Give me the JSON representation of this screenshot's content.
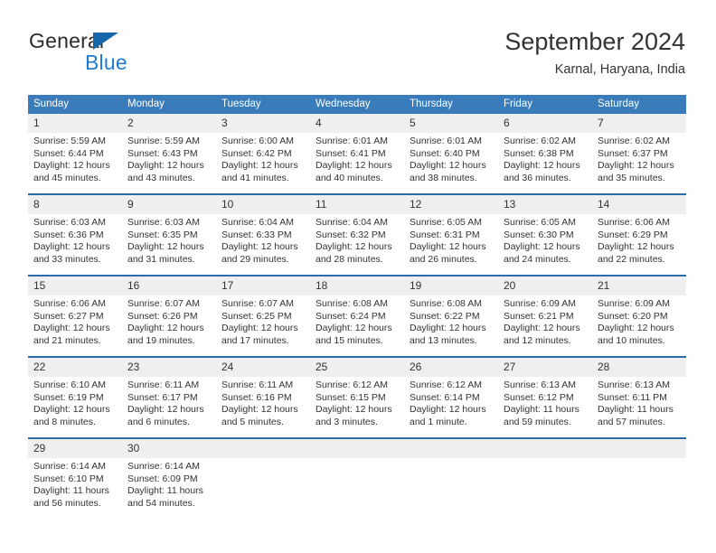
{
  "brand": {
    "name_part1": "General",
    "name_part2": "Blue",
    "triangle_color": "#1566ab",
    "blue_color": "#1f7dd1"
  },
  "header": {
    "title": "September 2024",
    "subtitle": "Karnal, Haryana, India"
  },
  "theme": {
    "header_bg": "#3a7cb9",
    "row_divider": "#2d6ca8",
    "daynum_bg": "#efefef",
    "text": "#333333"
  },
  "weekday_headers": [
    "Sunday",
    "Monday",
    "Tuesday",
    "Wednesday",
    "Thursday",
    "Friday",
    "Saturday"
  ],
  "labels": {
    "sunrise_prefix": "Sunrise: ",
    "sunset_prefix": "Sunset: ",
    "daylight_prefix": "Daylight: "
  },
  "weeks": [
    [
      {
        "day": "1",
        "sunrise": "Sunrise: 5:59 AM",
        "sunset": "Sunset: 6:44 PM",
        "daylight": "Daylight: 12 hours and 45 minutes."
      },
      {
        "day": "2",
        "sunrise": "Sunrise: 5:59 AM",
        "sunset": "Sunset: 6:43 PM",
        "daylight": "Daylight: 12 hours and 43 minutes."
      },
      {
        "day": "3",
        "sunrise": "Sunrise: 6:00 AM",
        "sunset": "Sunset: 6:42 PM",
        "daylight": "Daylight: 12 hours and 41 minutes."
      },
      {
        "day": "4",
        "sunrise": "Sunrise: 6:01 AM",
        "sunset": "Sunset: 6:41 PM",
        "daylight": "Daylight: 12 hours and 40 minutes."
      },
      {
        "day": "5",
        "sunrise": "Sunrise: 6:01 AM",
        "sunset": "Sunset: 6:40 PM",
        "daylight": "Daylight: 12 hours and 38 minutes."
      },
      {
        "day": "6",
        "sunrise": "Sunrise: 6:02 AM",
        "sunset": "Sunset: 6:38 PM",
        "daylight": "Daylight: 12 hours and 36 minutes."
      },
      {
        "day": "7",
        "sunrise": "Sunrise: 6:02 AM",
        "sunset": "Sunset: 6:37 PM",
        "daylight": "Daylight: 12 hours and 35 minutes."
      }
    ],
    [
      {
        "day": "8",
        "sunrise": "Sunrise: 6:03 AM",
        "sunset": "Sunset: 6:36 PM",
        "daylight": "Daylight: 12 hours and 33 minutes."
      },
      {
        "day": "9",
        "sunrise": "Sunrise: 6:03 AM",
        "sunset": "Sunset: 6:35 PM",
        "daylight": "Daylight: 12 hours and 31 minutes."
      },
      {
        "day": "10",
        "sunrise": "Sunrise: 6:04 AM",
        "sunset": "Sunset: 6:33 PM",
        "daylight": "Daylight: 12 hours and 29 minutes."
      },
      {
        "day": "11",
        "sunrise": "Sunrise: 6:04 AM",
        "sunset": "Sunset: 6:32 PM",
        "daylight": "Daylight: 12 hours and 28 minutes."
      },
      {
        "day": "12",
        "sunrise": "Sunrise: 6:05 AM",
        "sunset": "Sunset: 6:31 PM",
        "daylight": "Daylight: 12 hours and 26 minutes."
      },
      {
        "day": "13",
        "sunrise": "Sunrise: 6:05 AM",
        "sunset": "Sunset: 6:30 PM",
        "daylight": "Daylight: 12 hours and 24 minutes."
      },
      {
        "day": "14",
        "sunrise": "Sunrise: 6:06 AM",
        "sunset": "Sunset: 6:29 PM",
        "daylight": "Daylight: 12 hours and 22 minutes."
      }
    ],
    [
      {
        "day": "15",
        "sunrise": "Sunrise: 6:06 AM",
        "sunset": "Sunset: 6:27 PM",
        "daylight": "Daylight: 12 hours and 21 minutes."
      },
      {
        "day": "16",
        "sunrise": "Sunrise: 6:07 AM",
        "sunset": "Sunset: 6:26 PM",
        "daylight": "Daylight: 12 hours and 19 minutes."
      },
      {
        "day": "17",
        "sunrise": "Sunrise: 6:07 AM",
        "sunset": "Sunset: 6:25 PM",
        "daylight": "Daylight: 12 hours and 17 minutes."
      },
      {
        "day": "18",
        "sunrise": "Sunrise: 6:08 AM",
        "sunset": "Sunset: 6:24 PM",
        "daylight": "Daylight: 12 hours and 15 minutes."
      },
      {
        "day": "19",
        "sunrise": "Sunrise: 6:08 AM",
        "sunset": "Sunset: 6:22 PM",
        "daylight": "Daylight: 12 hours and 13 minutes."
      },
      {
        "day": "20",
        "sunrise": "Sunrise: 6:09 AM",
        "sunset": "Sunset: 6:21 PM",
        "daylight": "Daylight: 12 hours and 12 minutes."
      },
      {
        "day": "21",
        "sunrise": "Sunrise: 6:09 AM",
        "sunset": "Sunset: 6:20 PM",
        "daylight": "Daylight: 12 hours and 10 minutes."
      }
    ],
    [
      {
        "day": "22",
        "sunrise": "Sunrise: 6:10 AM",
        "sunset": "Sunset: 6:19 PM",
        "daylight": "Daylight: 12 hours and 8 minutes."
      },
      {
        "day": "23",
        "sunrise": "Sunrise: 6:11 AM",
        "sunset": "Sunset: 6:17 PM",
        "daylight": "Daylight: 12 hours and 6 minutes."
      },
      {
        "day": "24",
        "sunrise": "Sunrise: 6:11 AM",
        "sunset": "Sunset: 6:16 PM",
        "daylight": "Daylight: 12 hours and 5 minutes."
      },
      {
        "day": "25",
        "sunrise": "Sunrise: 6:12 AM",
        "sunset": "Sunset: 6:15 PM",
        "daylight": "Daylight: 12 hours and 3 minutes."
      },
      {
        "day": "26",
        "sunrise": "Sunrise: 6:12 AM",
        "sunset": "Sunset: 6:14 PM",
        "daylight": "Daylight: 12 hours and 1 minute."
      },
      {
        "day": "27",
        "sunrise": "Sunrise: 6:13 AM",
        "sunset": "Sunset: 6:12 PM",
        "daylight": "Daylight: 11 hours and 59 minutes."
      },
      {
        "day": "28",
        "sunrise": "Sunrise: 6:13 AM",
        "sunset": "Sunset: 6:11 PM",
        "daylight": "Daylight: 11 hours and 57 minutes."
      }
    ],
    [
      {
        "day": "29",
        "sunrise": "Sunrise: 6:14 AM",
        "sunset": "Sunset: 6:10 PM",
        "daylight": "Daylight: 11 hours and 56 minutes."
      },
      {
        "day": "30",
        "sunrise": "Sunrise: 6:14 AM",
        "sunset": "Sunset: 6:09 PM",
        "daylight": "Daylight: 11 hours and 54 minutes."
      },
      {
        "day": "",
        "sunrise": "",
        "sunset": "",
        "daylight": ""
      },
      {
        "day": "",
        "sunrise": "",
        "sunset": "",
        "daylight": ""
      },
      {
        "day": "",
        "sunrise": "",
        "sunset": "",
        "daylight": ""
      },
      {
        "day": "",
        "sunrise": "",
        "sunset": "",
        "daylight": ""
      },
      {
        "day": "",
        "sunrise": "",
        "sunset": "",
        "daylight": ""
      }
    ]
  ]
}
